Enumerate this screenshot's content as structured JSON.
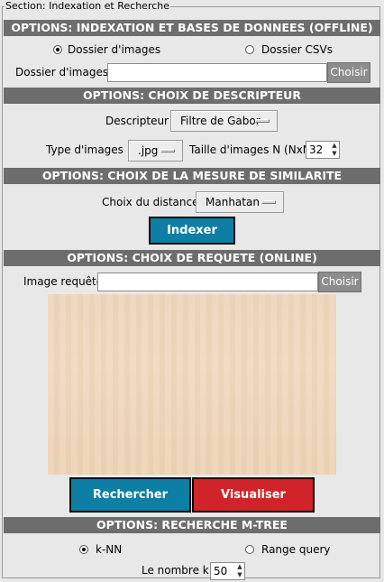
{
  "section_title": "Section: Indexation et Recherche",
  "offline": {
    "header": "OPTIONS: INDEXATION ET BASES DE DONNEES (OFFLINE)",
    "radio_images": "Dossier d'images",
    "radio_csvs": "Dossier CSVs",
    "folder_label": "Dossier d'images :",
    "folder_value": "",
    "choose_button": "Choisir"
  },
  "descriptor": {
    "header": "OPTIONS: CHOIX DE DESCRIPTEUR",
    "label": "Descripteur :",
    "value": "Filtre de Gabor",
    "type_label": "Type d'images :",
    "type_value": ".jpg",
    "size_label": "Taille d'images N (NxN):",
    "size_value": "32"
  },
  "similarity": {
    "header": "OPTIONS: CHOIX DE LA MESURE DE SIMILARITE",
    "label": "Choix du distance :",
    "value": "Manhatan",
    "index_button": "Indexer"
  },
  "query": {
    "header": "OPTIONS: CHOIX DE REQUETE (ONLINE)",
    "label": "Image requête:",
    "value": "",
    "choose_button": "Choisir",
    "search_button": "Rechercher",
    "visualize_button": "Visualiser"
  },
  "mtree": {
    "header": "OPTIONS: RECHERCHE M-TREE",
    "radio_knn": "k-NN",
    "radio_range": "Range query",
    "k_label": "Le nombre k :",
    "k_value": "50"
  },
  "colors": {
    "header_bg": "#6d6d6d",
    "blue_button": "#0e7fa4",
    "red_button": "#d1232a",
    "gray_button": "#8c8c8c"
  }
}
